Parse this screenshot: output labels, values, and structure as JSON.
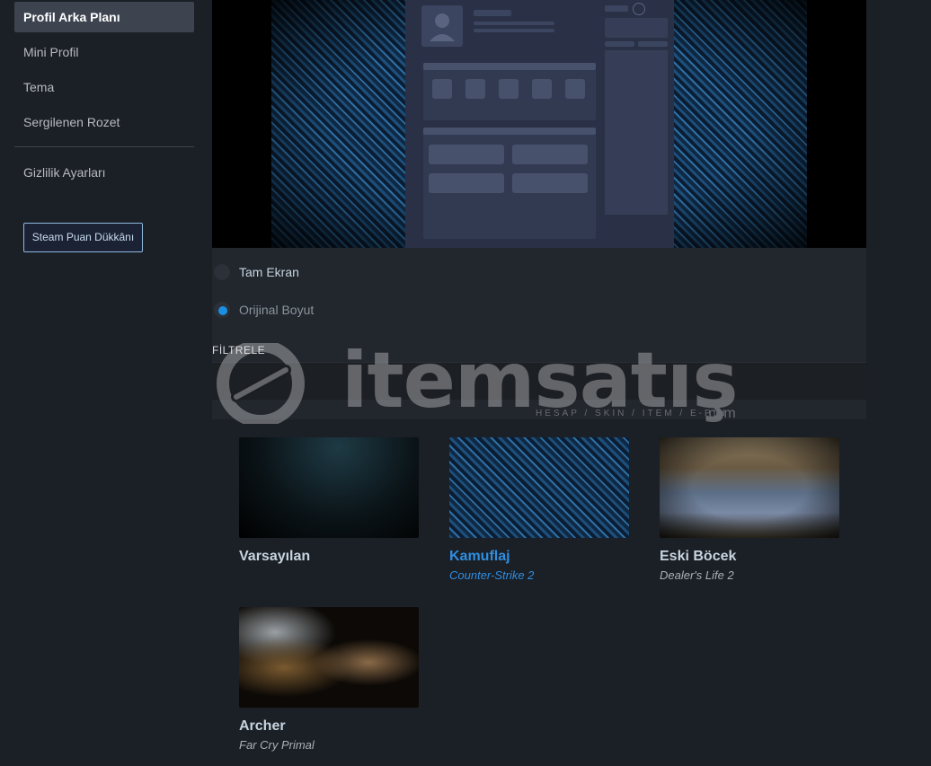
{
  "sidebar": {
    "items": [
      {
        "label": "Profil Arka Planı",
        "active": true
      },
      {
        "label": "Mini Profil"
      },
      {
        "label": "Tema"
      },
      {
        "label": "Sergilenen Rozet"
      },
      {
        "label": "Gizlilik Ayarları"
      }
    ],
    "shop_button": "Steam Puan Dükkânı"
  },
  "preview": {
    "options": [
      {
        "label": "Tam Ekran",
        "selected": false
      },
      {
        "label": "Orijinal Boyut",
        "selected": true
      }
    ]
  },
  "filter": {
    "label": "FİLTRELE",
    "value": ""
  },
  "backgrounds": [
    {
      "name": "Varsayılan",
      "game": "",
      "selected": false
    },
    {
      "name": "Kamuflaj",
      "game": "Counter-Strike 2",
      "selected": true
    },
    {
      "name": "Eski Böcek",
      "game": "Dealer's Life 2",
      "selected": false
    },
    {
      "name": "Archer",
      "game": "Far Cry Primal",
      "selected": false
    }
  ],
  "watermark": {
    "brand": "itemsatış",
    "tagline": "HESAP / SKIN / ITEM / E-PIN",
    "suffix": ".com"
  },
  "colors": {
    "accent": "#2f8ee0",
    "background": "#1b1f26",
    "panel": "#22262d"
  }
}
